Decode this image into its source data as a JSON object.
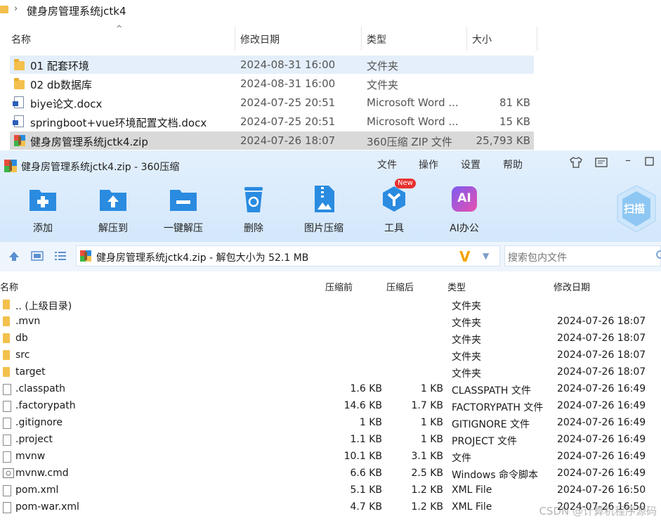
{
  "explorer": {
    "breadcrumb": "健身房管理系统jctk4",
    "columns": {
      "name": "名称",
      "modified": "修改日期",
      "type": "类型",
      "size": "大小"
    },
    "rows": [
      {
        "name": "01 配套环境",
        "date": "2024-08-31 16:00",
        "type": "文件夹",
        "size": "",
        "icon": "folder-icon",
        "state": "hover"
      },
      {
        "name": "02 db数据库",
        "date": "2024-08-31 16:00",
        "type": "文件夹",
        "size": "",
        "icon": "folder-icon",
        "state": ""
      },
      {
        "name": "biye论文.docx",
        "date": "2024-07-25 20:51",
        "type": "Microsoft Word ...",
        "size": "81 KB",
        "icon": "word-doc-icon",
        "state": ""
      },
      {
        "name": "springboot+vue环境配置文档.docx",
        "date": "2024-07-25 20:51",
        "type": "Microsoft Word ...",
        "size": "15 KB",
        "icon": "word-doc-icon",
        "state": ""
      },
      {
        "name": "健身房管理系统jctk4.zip",
        "date": "2024-07-26 18:07",
        "type": "360压缩 ZIP 文件",
        "size": "25,793 KB",
        "icon": "zip-archive-icon",
        "state": "selected"
      }
    ]
  },
  "zip": {
    "title": "健身房管理系统jctk4.zip - 360压缩",
    "menu": [
      "文件",
      "操作",
      "设置",
      "帮助"
    ],
    "toolbar": [
      {
        "label": "添加",
        "icon": "add-folder-icon"
      },
      {
        "label": "解压到",
        "icon": "extract-to-icon"
      },
      {
        "label": "一键解压",
        "icon": "one-click-extract-icon"
      },
      {
        "label": "删除",
        "icon": "recycle-delete-icon"
      },
      {
        "label": "图片压缩",
        "icon": "image-compress-icon"
      },
      {
        "label": "工具",
        "icon": "tools-icon",
        "badge": "New"
      },
      {
        "label": "AI办公",
        "icon": "ai-office-icon",
        "mark": "AI"
      }
    ],
    "scan_label": "扫描",
    "address": "健身房管理系统jctk4.zip - 解包大小为 52.1 MB",
    "search_placeholder": "搜索包内文件",
    "columns": {
      "name": "名称",
      "orig": "压缩前",
      "comp": "压缩后",
      "type": "类型",
      "date": "修改日期"
    },
    "rows": [
      {
        "name": ".. (上级目录)",
        "orig": "",
        "comp": "",
        "type": "文件夹",
        "date": "",
        "kind": "folder"
      },
      {
        "name": ".mvn",
        "orig": "",
        "comp": "",
        "type": "文件夹",
        "date": "2024-07-26 18:07",
        "kind": "folder"
      },
      {
        "name": "db",
        "orig": "",
        "comp": "",
        "type": "文件夹",
        "date": "2024-07-26 18:07",
        "kind": "folder"
      },
      {
        "name": "src",
        "orig": "",
        "comp": "",
        "type": "文件夹",
        "date": "2024-07-26 18:07",
        "kind": "folder"
      },
      {
        "name": "target",
        "orig": "",
        "comp": "",
        "type": "文件夹",
        "date": "2024-07-26 18:07",
        "kind": "folder"
      },
      {
        "name": ".classpath",
        "orig": "1.6 KB",
        "comp": "1 KB",
        "type": "CLASSPATH 文件",
        "date": "2024-07-26 16:49",
        "kind": "file"
      },
      {
        "name": ".factorypath",
        "orig": "14.6 KB",
        "comp": "1.7 KB",
        "type": "FACTORYPATH 文件",
        "date": "2024-07-26 16:49",
        "kind": "file"
      },
      {
        "name": ".gitignore",
        "orig": "1 KB",
        "comp": "1 KB",
        "type": "GITIGNORE 文件",
        "date": "2024-07-26 16:49",
        "kind": "file"
      },
      {
        "name": ".project",
        "orig": "1.1 KB",
        "comp": "1 KB",
        "type": "PROJECT 文件",
        "date": "2024-07-26 16:49",
        "kind": "file"
      },
      {
        "name": "mvnw",
        "orig": "10.1 KB",
        "comp": "3.1 KB",
        "type": "文件",
        "date": "2024-07-26 16:49",
        "kind": "file"
      },
      {
        "name": "mvnw.cmd",
        "orig": "6.6 KB",
        "comp": "2.5 KB",
        "type": "Windows 命令脚本",
        "date": "2024-07-26 16:49",
        "kind": "cmd"
      },
      {
        "name": "pom.xml",
        "orig": "5.1 KB",
        "comp": "1.2 KB",
        "type": "XML File",
        "date": "2024-07-26 16:50",
        "kind": "file"
      },
      {
        "name": "pom-war.xml",
        "orig": "4.7 KB",
        "comp": "1.2 KB",
        "type": "XML File",
        "date": "2024-07-26 16:50",
        "kind": "file"
      }
    ]
  },
  "watermark": "CSDN @计算机程序源码",
  "colors": {
    "accent": "#2a8be0",
    "selection": "#d9d9d9",
    "hover": "#e4effb",
    "folder": "#f4c04c"
  }
}
